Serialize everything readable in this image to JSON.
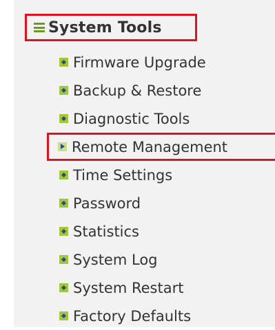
{
  "section": {
    "title": "System Tools",
    "icon": "menu-lines-icon"
  },
  "menu": {
    "items": [
      {
        "label": "Firmware Upgrade",
        "icon": "diamond-bullet-icon"
      },
      {
        "label": "Backup & Restore",
        "icon": "diamond-bullet-icon"
      },
      {
        "label": "Diagnostic Tools",
        "icon": "diamond-bullet-icon"
      },
      {
        "label": "Remote Management",
        "icon": "play-bullet-icon",
        "selected": true
      },
      {
        "label": "Time Settings",
        "icon": "diamond-bullet-icon"
      },
      {
        "label": "Password",
        "icon": "diamond-bullet-icon"
      },
      {
        "label": "Statistics",
        "icon": "diamond-bullet-icon"
      },
      {
        "label": "System Log",
        "icon": "diamond-bullet-icon"
      },
      {
        "label": "System Restart",
        "icon": "diamond-bullet-icon"
      },
      {
        "label": "Factory Defaults",
        "icon": "diamond-bullet-icon"
      }
    ]
  },
  "colors": {
    "highlight_border": "#e0121f",
    "bullet_green": "#a6c63a",
    "bullet_mark": "#1f4e8c",
    "panel_background": "#f2f2f2"
  }
}
